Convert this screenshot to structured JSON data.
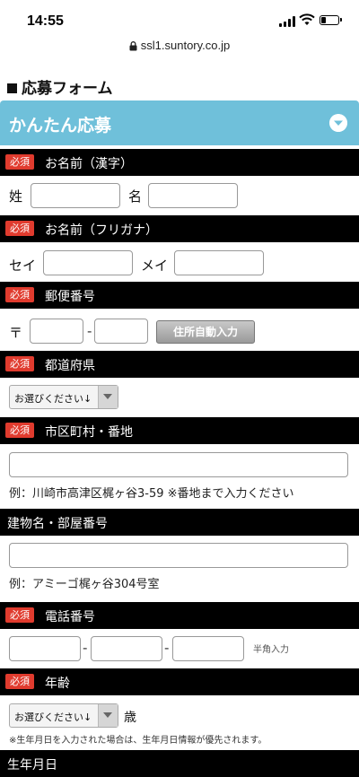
{
  "status": {
    "time": "14:55",
    "battery_level": 0.3
  },
  "browser": {
    "url": "ssl1.suntory.co.jp"
  },
  "form": {
    "title": "応募フォーム",
    "accordion_title": "かんたん応募",
    "required_label": "必須",
    "sections": {
      "name_kanji": {
        "label": "お名前（漢字）",
        "last_label": "姓",
        "first_label": "名"
      },
      "name_kana": {
        "label": "お名前（フリガナ）",
        "last_label": "セイ",
        "first_label": "メイ"
      },
      "postal": {
        "label": "郵便番号",
        "prefix": "〒",
        "dash": "-",
        "button": "住所自動入力"
      },
      "prefecture": {
        "label": "都道府県",
        "select_value": "お選びください↓"
      },
      "city": {
        "label": "市区町村・番地",
        "example": "例：川崎市高津区梶ヶ谷3-59 ※番地まで入力ください"
      },
      "building": {
        "label": "建物名・部屋番号",
        "example": "例：アミーゴ梶ヶ谷304号室"
      },
      "phone": {
        "label": "電話番号",
        "dash": "-",
        "note": "半角入力"
      },
      "age": {
        "label": "年齢",
        "select_value": "お選びください↓",
        "unit": "歳",
        "note": "※生年月日を入力された場合は、生年月日情報が優先されます。"
      },
      "birthday": {
        "label": "生年月日"
      }
    }
  }
}
